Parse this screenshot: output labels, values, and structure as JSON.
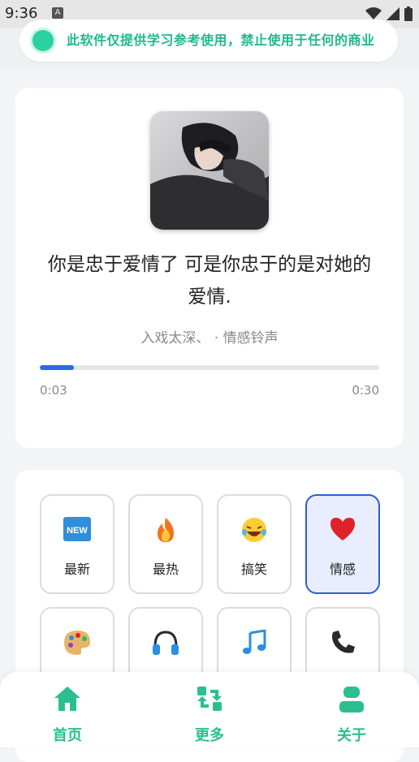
{
  "status_bar": {
    "time": "9:36",
    "notification_glyph": "A",
    "icons": [
      "wifi-icon",
      "signal-icon",
      "battery-icon"
    ]
  },
  "notice": {
    "text": "此软件仅提供学习参考使用，禁止使用于任何的商业",
    "accent": "#2bd1a0"
  },
  "player": {
    "title": "你是忠于爱情了 可是你忠于的是对她的爱情.",
    "subtitle": "入戏太深、 · 情感铃声",
    "elapsed": "0:03",
    "duration": "0:30",
    "progress_fraction": 0.1,
    "accent": "#2a6ae6"
  },
  "categories": [
    {
      "label": "最新",
      "icon": "new-icon",
      "active": false
    },
    {
      "label": "最热",
      "icon": "fire-icon",
      "active": false
    },
    {
      "label": "搞笑",
      "icon": "laughing-face-icon",
      "active": false
    },
    {
      "label": "情感",
      "icon": "heart-icon",
      "active": true
    },
    {
      "label": "",
      "icon": "palette-icon",
      "active": false
    },
    {
      "label": "",
      "icon": "headphones-icon",
      "active": false
    },
    {
      "label": "",
      "icon": "music-note-icon",
      "active": false
    },
    {
      "label": "",
      "icon": "phone-icon",
      "active": false
    }
  ],
  "bottom_nav": {
    "items": [
      {
        "label": "首页",
        "icon": "home-icon"
      },
      {
        "label": "更多",
        "icon": "refresh-icon"
      },
      {
        "label": "关于",
        "icon": "user-icon"
      }
    ],
    "color": "#2bbf8f"
  }
}
